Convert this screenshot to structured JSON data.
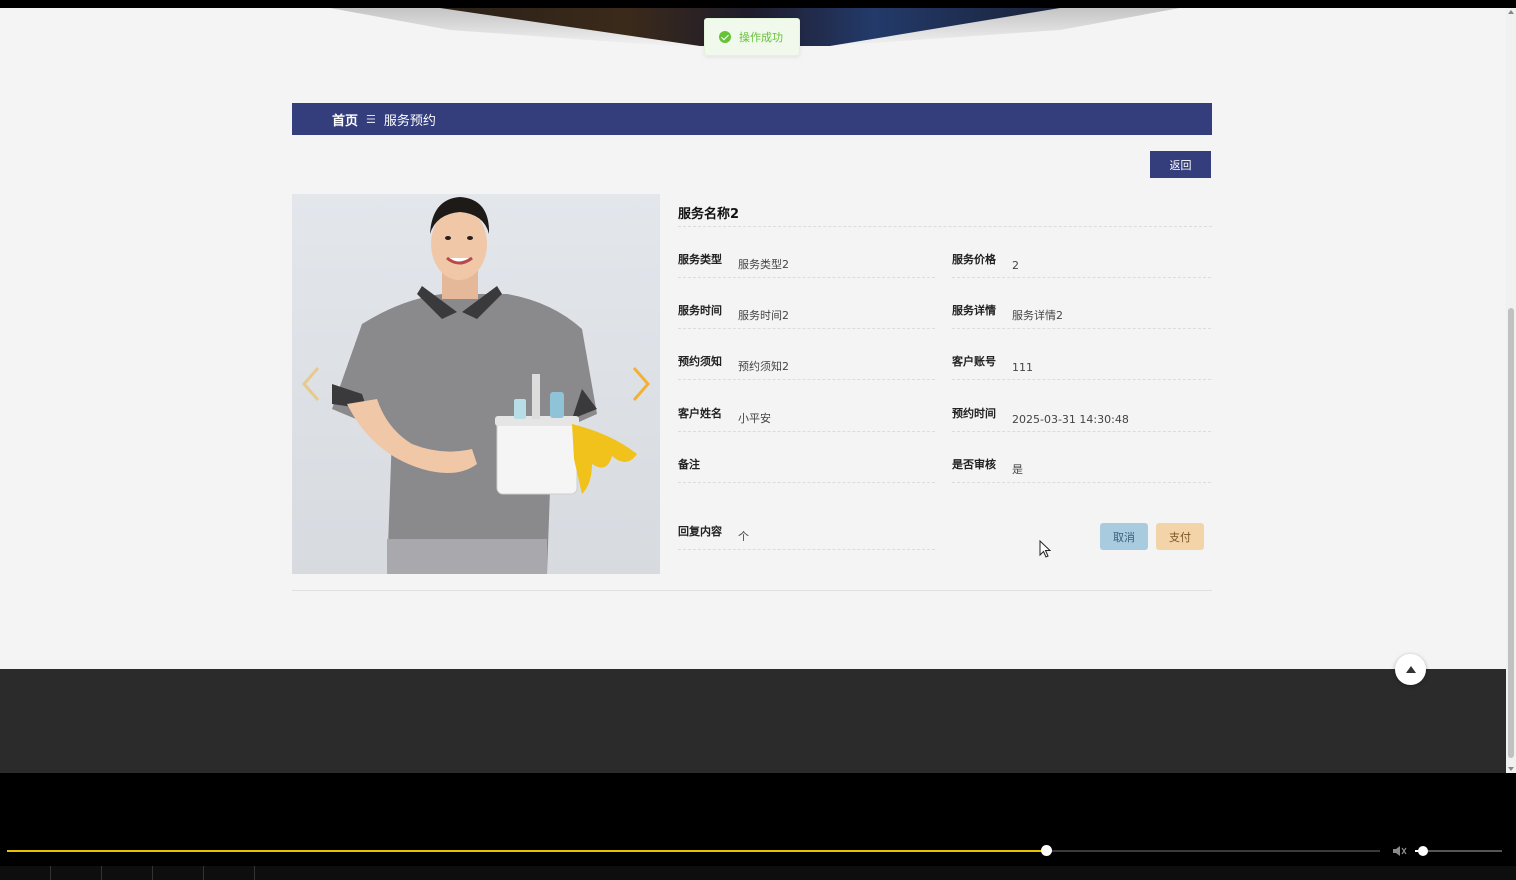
{
  "toast": {
    "text": "操作成功"
  },
  "breadcrumb": {
    "home": "首页",
    "separator": "☰",
    "current": "服务预约"
  },
  "back_button": "返回",
  "service": {
    "title": "服务名称2",
    "fields": {
      "type": {
        "label": "服务类型",
        "value": "服务类型2"
      },
      "price": {
        "label": "服务价格",
        "value": "2"
      },
      "time": {
        "label": "服务时间",
        "value": "服务时间2"
      },
      "details": {
        "label": "服务详情",
        "value": "服务详情2"
      },
      "notice": {
        "label": "预约须知",
        "value": "预约须知2"
      },
      "account": {
        "label": "客户账号",
        "value": "111"
      },
      "name": {
        "label": "客户姓名",
        "value": "小平安"
      },
      "booking_time": {
        "label": "预约时间",
        "value": "2025-03-31 14:30:48"
      },
      "remark": {
        "label": "备注",
        "value": ""
      },
      "reviewed": {
        "label": "是否审核",
        "value": "是"
      },
      "reply": {
        "label": "回复内容",
        "value": "个"
      }
    }
  },
  "actions": {
    "cancel": "取消",
    "pay": "支付"
  },
  "colors": {
    "brand": "#343e7c",
    "cancel": "#a9cbe0",
    "pay": "#f3d4a8",
    "arrow": "#f2b134",
    "toast_green": "#67c23a",
    "progress": "#e6c200"
  },
  "icons": {
    "toast": "success-check-icon",
    "prev": "chevron-left-icon",
    "next": "chevron-right-icon",
    "top": "back-to-top-icon",
    "volume": "volume-icon"
  },
  "player": {
    "progress": 0.757,
    "volume": 0.09
  }
}
